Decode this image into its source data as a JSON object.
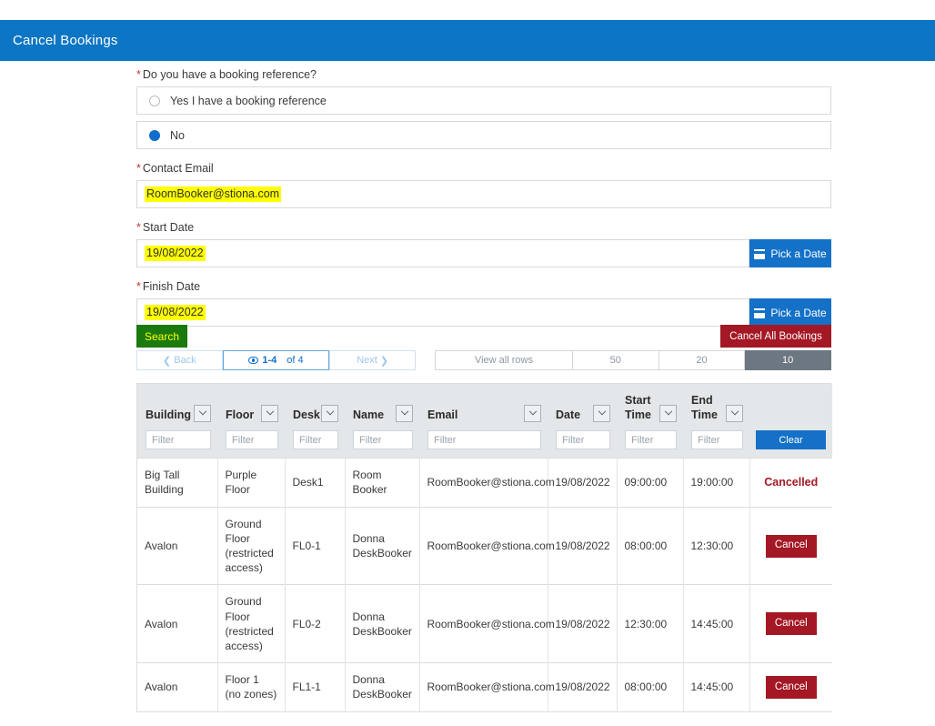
{
  "header": {
    "title": "Cancel Bookings",
    "bg": "#0c75c4"
  },
  "form": {
    "booking_ref_label": "Do you have a booking reference?",
    "options": [
      {
        "label": "Yes I have a booking reference",
        "selected": false
      },
      {
        "label": "No",
        "selected": true
      }
    ],
    "contact_email_label": "Contact Email",
    "contact_email_value": "RoomBooker@stiona.com",
    "start_date_label": "Start Date",
    "start_date_value": "19/08/2022",
    "finish_date_label": "Finish Date",
    "finish_date_value": "19/08/2022",
    "pick_date_label": "Pick a Date",
    "required_marker": "*"
  },
  "actions": {
    "search_label": "Search",
    "search_bg": "#1a7a0e",
    "cancel_all_label": "Cancel All Bookings",
    "cancel_all_bg": "#a31824"
  },
  "pager": {
    "back_label": "Back",
    "count_label": "1-4",
    "count_suffix": "of 4",
    "next_label": "Next",
    "rows_options": [
      {
        "label": "View all rows",
        "active": false
      },
      {
        "label": "50",
        "active": false
      },
      {
        "label": "20",
        "active": false
      },
      {
        "label": "10",
        "active": true
      }
    ]
  },
  "table": {
    "filter_placeholder": "Filter",
    "clear_label": "Clear",
    "columns": [
      "Building",
      "Floor",
      "Desk",
      "Name",
      "Email",
      "Date",
      "Start Time",
      "End Time"
    ],
    "rows": [
      {
        "building": "Big Tall Building",
        "floor": "Purple Floor",
        "desk": "Desk1",
        "name": "Room Booker",
        "email": "RoomBooker@stiona.com",
        "date": "19/08/2022",
        "start_time": "09:00:00",
        "end_time": "19:00:00",
        "action": "Cancelled",
        "action_type": "text"
      },
      {
        "building": "Avalon",
        "floor": "Ground Floor (restricted access)",
        "desk": "FL0-1",
        "name": "Donna DeskBooker",
        "email": "RoomBooker@stiona.com",
        "date": "19/08/2022",
        "start_time": "08:00:00",
        "end_time": "12:30:00",
        "action": "Cancel",
        "action_type": "button"
      },
      {
        "building": "Avalon",
        "floor": "Ground Floor (restricted access)",
        "desk": "FL0-2",
        "name": "Donna DeskBooker",
        "email": "RoomBooker@stiona.com",
        "date": "19/08/2022",
        "start_time": "12:30:00",
        "end_time": "14:45:00",
        "action": "Cancel",
        "action_type": "button"
      },
      {
        "building": "Avalon",
        "floor": "Floor 1 (no zones)",
        "desk": "FL1-1",
        "name": "Donna DeskBooker",
        "email": "RoomBooker@stiona.com",
        "date": "19/08/2022",
        "start_time": "08:00:00",
        "end_time": "14:45:00",
        "action": "Cancel",
        "action_type": "button"
      }
    ]
  }
}
